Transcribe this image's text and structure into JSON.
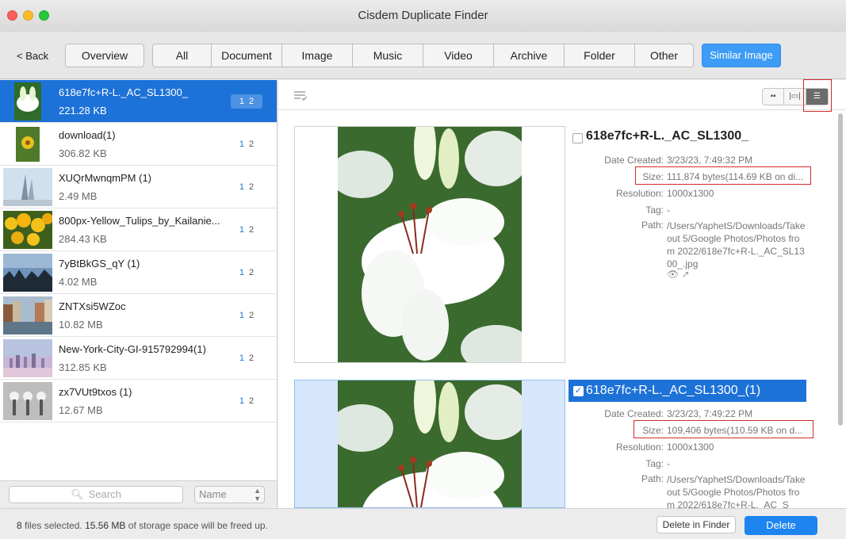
{
  "window": {
    "title": "Cisdem Duplicate Finder"
  },
  "toolbar": {
    "back_label": "< Back",
    "overview_label": "Overview",
    "tabs": [
      "All",
      "Document",
      "Image",
      "Music",
      "Video",
      "Archive",
      "Folder",
      "Other"
    ],
    "similar_label": "Similar Image",
    "accent": "#3d9cf5"
  },
  "file_list": [
    {
      "name": "618e7fc+R-L._AC_SL1300_",
      "size": "221.28 KB",
      "b1": "1",
      "b2": "2",
      "selected": true
    },
    {
      "name": "download(1)",
      "size": "306.82 KB",
      "b1": "1",
      "b2": "2"
    },
    {
      "name": "XUQrMwnqmPM (1)",
      "size": "2.49 MB",
      "b1": "1",
      "b2": "2"
    },
    {
      "name": "800px-Yellow_Tulips_by_Kailanie...",
      "size": "284.43 KB",
      "b1": "1",
      "b2": "2"
    },
    {
      "name": "7yBtBkGS_qY (1)",
      "size": "4.02 MB",
      "b1": "1",
      "b2": "2"
    },
    {
      "name": "ZNTXsi5WZoc",
      "size": "10.82 MB",
      "b1": "1",
      "b2": "2"
    },
    {
      "name": "New-York-City-GI-915792994(1)",
      "size": "312.85 KB",
      "b1": "1",
      "b2": "2"
    },
    {
      "name": "zx7VUt9txos (1)",
      "size": "12.67 MB",
      "b1": "1",
      "b2": "2"
    }
  ],
  "left_bottom": {
    "search_placeholder": "Search",
    "sort_value": "Name"
  },
  "labels": {
    "date": "Date Created:",
    "size": "Size:",
    "resolution": "Resolution:",
    "tag": "Tag:",
    "path": "Path:"
  },
  "details": [
    {
      "title": "618e7fc+R-L._AC_SL1300_",
      "date": "3/23/23, 7:49:32 PM",
      "size": "111,874 bytes(114.69 KB on di...",
      "resolution": "1000x1300",
      "tag": "-",
      "path": "/Users/YaphetS/Downloads/Takeout 5/Google Photos/Photos from 2022/618e7fc+R-L._AC_SL1300_.jpg",
      "checked": false
    },
    {
      "title": "618e7fc+R-L._AC_SL1300_(1)",
      "date": "3/23/23, 7:49:22 PM",
      "size": "109,406 bytes(110.59 KB on d...",
      "resolution": "1000x1300",
      "tag": "-",
      "path": "/Users/YaphetS/Downloads/Takeout 5/Google Photos/Photos from 2022/618e7fc+R-L._AC_S",
      "checked": true
    }
  ],
  "footer": {
    "count": "8",
    "status_mid": " files selected. ",
    "freed": "15.56 MB",
    "status_end": " of storage space will be freed up.",
    "delete_in_finder": "Delete in Finder",
    "delete": "Delete"
  }
}
